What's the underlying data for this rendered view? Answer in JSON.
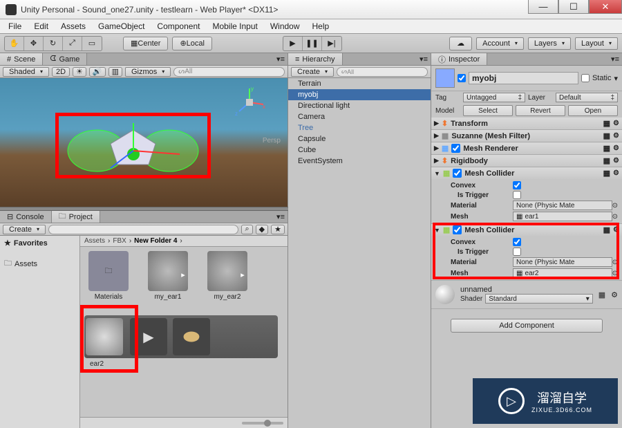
{
  "window": {
    "title": "Unity Personal - Sound_one27.unity - testlearn - Web Player* <DX11>"
  },
  "menu": [
    "File",
    "Edit",
    "Assets",
    "GameObject",
    "Component",
    "Mobile Input",
    "Window",
    "Help"
  ],
  "toolbar": {
    "center": "Center",
    "local": "Local",
    "account": "Account",
    "layers": "Layers",
    "layout": "Layout"
  },
  "scene": {
    "tab1": "Scene",
    "tab2": "Game",
    "shading": "Shaded",
    "mode2d": "2D",
    "gizmos": "Gizmos",
    "allsearch": "All",
    "persp": "Persp"
  },
  "project": {
    "tab_console": "Console",
    "tab_project": "Project",
    "create": "Create",
    "fav": "Favorites",
    "assets": "Assets",
    "breadcrumb": [
      "Assets",
      "FBX",
      "New Folder 4"
    ],
    "thumbs_row1": [
      "Materials",
      "my_ear1",
      "my_ear2"
    ],
    "sel_thumb": "ear2"
  },
  "hierarchy": {
    "tab": "Hierarchy",
    "create": "Create",
    "search": "All",
    "items": [
      "Terrain",
      "myobj",
      "Directional light",
      "Camera",
      "Tree",
      "Capsule",
      "Cube",
      "EventSystem"
    ]
  },
  "inspector": {
    "tab": "Inspector",
    "obj_name": "myobj",
    "static": "Static",
    "tag_lbl": "Tag",
    "tag_val": "Untagged",
    "layer_lbl": "Layer",
    "layer_val": "Default",
    "model_lbl": "Model",
    "select": "Select",
    "revert": "Revert",
    "open": "Open",
    "comps": {
      "transform": "Transform",
      "suzanne": "Suzanne (Mesh Filter)",
      "meshrend": "Mesh Renderer",
      "rigid": "Rigidbody",
      "meshcol1": "Mesh Collider",
      "meshcol2": "Mesh Collider"
    },
    "mc": {
      "convex": "Convex",
      "istrigger": "Is Trigger",
      "material": "Material",
      "mesh": "Mesh",
      "matval": "None (Physic Mate",
      "mesh1": "ear1",
      "mesh2": "ear2"
    },
    "material": {
      "name": "unnamed",
      "shader_lbl": "Shader",
      "shader_val": "Standard"
    },
    "addcomp": "Add Component"
  },
  "watermark": {
    "main": "溜溜自学",
    "sub": "ZIXUE.3D66.COM"
  }
}
